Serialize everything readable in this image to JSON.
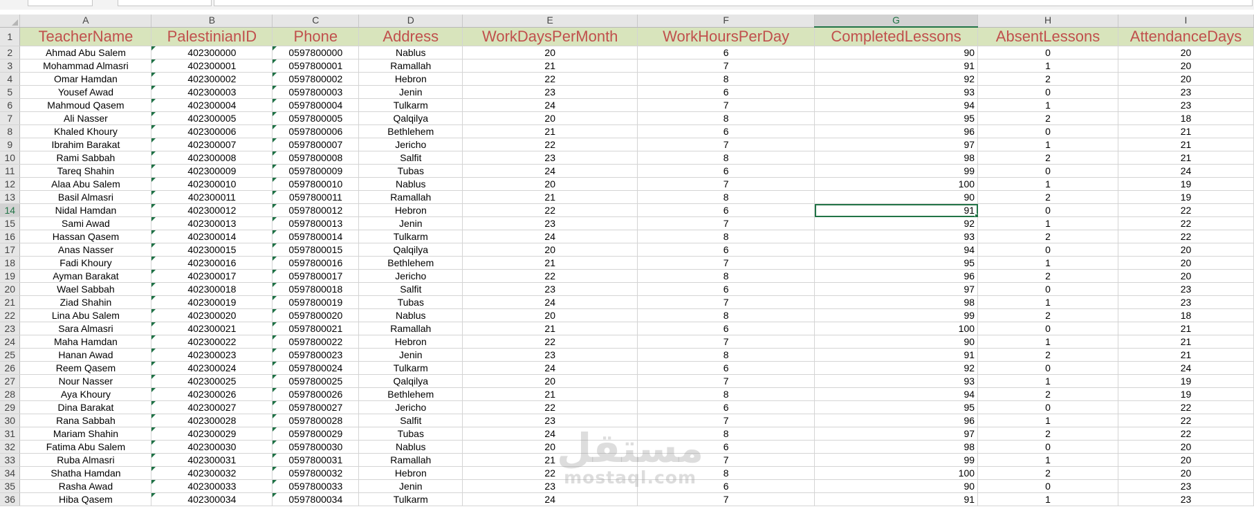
{
  "columns": [
    "A",
    "B",
    "C",
    "D",
    "E",
    "F",
    "G",
    "H",
    "I"
  ],
  "selected_column": "G",
  "selected_row": 14,
  "headers": [
    "TeacherName",
    "PalestinianID",
    "Phone",
    "Address",
    "WorkDaysPerMonth",
    "WorkHoursPerDay",
    "CompletedLessons",
    "AbsentLessons",
    "AttendanceDays"
  ],
  "rows": [
    {
      "num": 2,
      "name": "Ahmad Abu Salem",
      "id": "402300000",
      "phone": "0597800000",
      "address": "Nablus",
      "days": "20",
      "hours": "6",
      "completed": "90",
      "absent": "0",
      "attendance": "20"
    },
    {
      "num": 3,
      "name": "Mohammad Almasri",
      "id": "402300001",
      "phone": "0597800001",
      "address": "Ramallah",
      "days": "21",
      "hours": "7",
      "completed": "91",
      "absent": "1",
      "attendance": "20"
    },
    {
      "num": 4,
      "name": "Omar Hamdan",
      "id": "402300002",
      "phone": "0597800002",
      "address": "Hebron",
      "days": "22",
      "hours": "8",
      "completed": "92",
      "absent": "2",
      "attendance": "20"
    },
    {
      "num": 5,
      "name": "Yousef Awad",
      "id": "402300003",
      "phone": "0597800003",
      "address": "Jenin",
      "days": "23",
      "hours": "6",
      "completed": "93",
      "absent": "0",
      "attendance": "23"
    },
    {
      "num": 6,
      "name": "Mahmoud Qasem",
      "id": "402300004",
      "phone": "0597800004",
      "address": "Tulkarm",
      "days": "24",
      "hours": "7",
      "completed": "94",
      "absent": "1",
      "attendance": "23"
    },
    {
      "num": 7,
      "name": "Ali Nasser",
      "id": "402300005",
      "phone": "0597800005",
      "address": "Qalqilya",
      "days": "20",
      "hours": "8",
      "completed": "95",
      "absent": "2",
      "attendance": "18"
    },
    {
      "num": 8,
      "name": "Khaled Khoury",
      "id": "402300006",
      "phone": "0597800006",
      "address": "Bethlehem",
      "days": "21",
      "hours": "6",
      "completed": "96",
      "absent": "0",
      "attendance": "21"
    },
    {
      "num": 9,
      "name": "Ibrahim Barakat",
      "id": "402300007",
      "phone": "0597800007",
      "address": "Jericho",
      "days": "22",
      "hours": "7",
      "completed": "97",
      "absent": "1",
      "attendance": "21"
    },
    {
      "num": 10,
      "name": "Rami Sabbah",
      "id": "402300008",
      "phone": "0597800008",
      "address": "Salfit",
      "days": "23",
      "hours": "8",
      "completed": "98",
      "absent": "2",
      "attendance": "21"
    },
    {
      "num": 11,
      "name": "Tareq Shahin",
      "id": "402300009",
      "phone": "0597800009",
      "address": "Tubas",
      "days": "24",
      "hours": "6",
      "completed": "99",
      "absent": "0",
      "attendance": "24"
    },
    {
      "num": 12,
      "name": "Alaa Abu Salem",
      "id": "402300010",
      "phone": "0597800010",
      "address": "Nablus",
      "days": "20",
      "hours": "7",
      "completed": "100",
      "absent": "1",
      "attendance": "19"
    },
    {
      "num": 13,
      "name": "Basil Almasri",
      "id": "402300011",
      "phone": "0597800011",
      "address": "Ramallah",
      "days": "21",
      "hours": "8",
      "completed": "90",
      "absent": "2",
      "attendance": "19"
    },
    {
      "num": 14,
      "name": "Nidal Hamdan",
      "id": "402300012",
      "phone": "0597800012",
      "address": "Hebron",
      "days": "22",
      "hours": "6",
      "completed": "91",
      "absent": "0",
      "attendance": "22"
    },
    {
      "num": 15,
      "name": "Sami Awad",
      "id": "402300013",
      "phone": "0597800013",
      "address": "Jenin",
      "days": "23",
      "hours": "7",
      "completed": "92",
      "absent": "1",
      "attendance": "22"
    },
    {
      "num": 16,
      "name": "Hassan Qasem",
      "id": "402300014",
      "phone": "0597800014",
      "address": "Tulkarm",
      "days": "24",
      "hours": "8",
      "completed": "93",
      "absent": "2",
      "attendance": "22"
    },
    {
      "num": 17,
      "name": "Anas Nasser",
      "id": "402300015",
      "phone": "0597800015",
      "address": "Qalqilya",
      "days": "20",
      "hours": "6",
      "completed": "94",
      "absent": "0",
      "attendance": "20"
    },
    {
      "num": 18,
      "name": "Fadi Khoury",
      "id": "402300016",
      "phone": "0597800016",
      "address": "Bethlehem",
      "days": "21",
      "hours": "7",
      "completed": "95",
      "absent": "1",
      "attendance": "20"
    },
    {
      "num": 19,
      "name": "Ayman Barakat",
      "id": "402300017",
      "phone": "0597800017",
      "address": "Jericho",
      "days": "22",
      "hours": "8",
      "completed": "96",
      "absent": "2",
      "attendance": "20"
    },
    {
      "num": 20,
      "name": "Wael Sabbah",
      "id": "402300018",
      "phone": "0597800018",
      "address": "Salfit",
      "days": "23",
      "hours": "6",
      "completed": "97",
      "absent": "0",
      "attendance": "23"
    },
    {
      "num": 21,
      "name": "Ziad Shahin",
      "id": "402300019",
      "phone": "0597800019",
      "address": "Tubas",
      "days": "24",
      "hours": "7",
      "completed": "98",
      "absent": "1",
      "attendance": "23"
    },
    {
      "num": 22,
      "name": "Lina Abu Salem",
      "id": "402300020",
      "phone": "0597800020",
      "address": "Nablus",
      "days": "20",
      "hours": "8",
      "completed": "99",
      "absent": "2",
      "attendance": "18"
    },
    {
      "num": 23,
      "name": "Sara Almasri",
      "id": "402300021",
      "phone": "0597800021",
      "address": "Ramallah",
      "days": "21",
      "hours": "6",
      "completed": "100",
      "absent": "0",
      "attendance": "21"
    },
    {
      "num": 24,
      "name": "Maha Hamdan",
      "id": "402300022",
      "phone": "0597800022",
      "address": "Hebron",
      "days": "22",
      "hours": "7",
      "completed": "90",
      "absent": "1",
      "attendance": "21"
    },
    {
      "num": 25,
      "name": "Hanan Awad",
      "id": "402300023",
      "phone": "0597800023",
      "address": "Jenin",
      "days": "23",
      "hours": "8",
      "completed": "91",
      "absent": "2",
      "attendance": "21"
    },
    {
      "num": 26,
      "name": "Reem Qasem",
      "id": "402300024",
      "phone": "0597800024",
      "address": "Tulkarm",
      "days": "24",
      "hours": "6",
      "completed": "92",
      "absent": "0",
      "attendance": "24"
    },
    {
      "num": 27,
      "name": "Nour Nasser",
      "id": "402300025",
      "phone": "0597800025",
      "address": "Qalqilya",
      "days": "20",
      "hours": "7",
      "completed": "93",
      "absent": "1",
      "attendance": "19"
    },
    {
      "num": 28,
      "name": "Aya Khoury",
      "id": "402300026",
      "phone": "0597800026",
      "address": "Bethlehem",
      "days": "21",
      "hours": "8",
      "completed": "94",
      "absent": "2",
      "attendance": "19"
    },
    {
      "num": 29,
      "name": "Dina Barakat",
      "id": "402300027",
      "phone": "0597800027",
      "address": "Jericho",
      "days": "22",
      "hours": "6",
      "completed": "95",
      "absent": "0",
      "attendance": "22"
    },
    {
      "num": 30,
      "name": "Rana Sabbah",
      "id": "402300028",
      "phone": "0597800028",
      "address": "Salfit",
      "days": "23",
      "hours": "7",
      "completed": "96",
      "absent": "1",
      "attendance": "22"
    },
    {
      "num": 31,
      "name": "Mariam Shahin",
      "id": "402300029",
      "phone": "0597800029",
      "address": "Tubas",
      "days": "24",
      "hours": "8",
      "completed": "97",
      "absent": "2",
      "attendance": "22"
    },
    {
      "num": 32,
      "name": "Fatima Abu Salem",
      "id": "402300030",
      "phone": "0597800030",
      "address": "Nablus",
      "days": "20",
      "hours": "6",
      "completed": "98",
      "absent": "0",
      "attendance": "20"
    },
    {
      "num": 33,
      "name": "Ruba Almasri",
      "id": "402300031",
      "phone": "0597800031",
      "address": "Ramallah",
      "days": "21",
      "hours": "7",
      "completed": "99",
      "absent": "1",
      "attendance": "20"
    },
    {
      "num": 34,
      "name": "Shatha Hamdan",
      "id": "402300032",
      "phone": "0597800032",
      "address": "Hebron",
      "days": "22",
      "hours": "8",
      "completed": "100",
      "absent": "2",
      "attendance": "20"
    },
    {
      "num": 35,
      "name": "Rasha Awad",
      "id": "402300033",
      "phone": "0597800033",
      "address": "Jenin",
      "days": "23",
      "hours": "6",
      "completed": "90",
      "absent": "0",
      "attendance": "23"
    },
    {
      "num": 36,
      "name": "Hiba Qasem",
      "id": "402300034",
      "phone": "0597800034",
      "address": "Tulkarm",
      "days": "24",
      "hours": "7",
      "completed": "91",
      "absent": "1",
      "attendance": "23"
    }
  ],
  "watermark": {
    "arabic": "مستقل",
    "latin": "mostaql.com"
  },
  "colors": {
    "header_fill": "#d8e4bc",
    "header_text": "#c0504d",
    "selection": "#217346",
    "error_triangle": "#1e7145"
  }
}
